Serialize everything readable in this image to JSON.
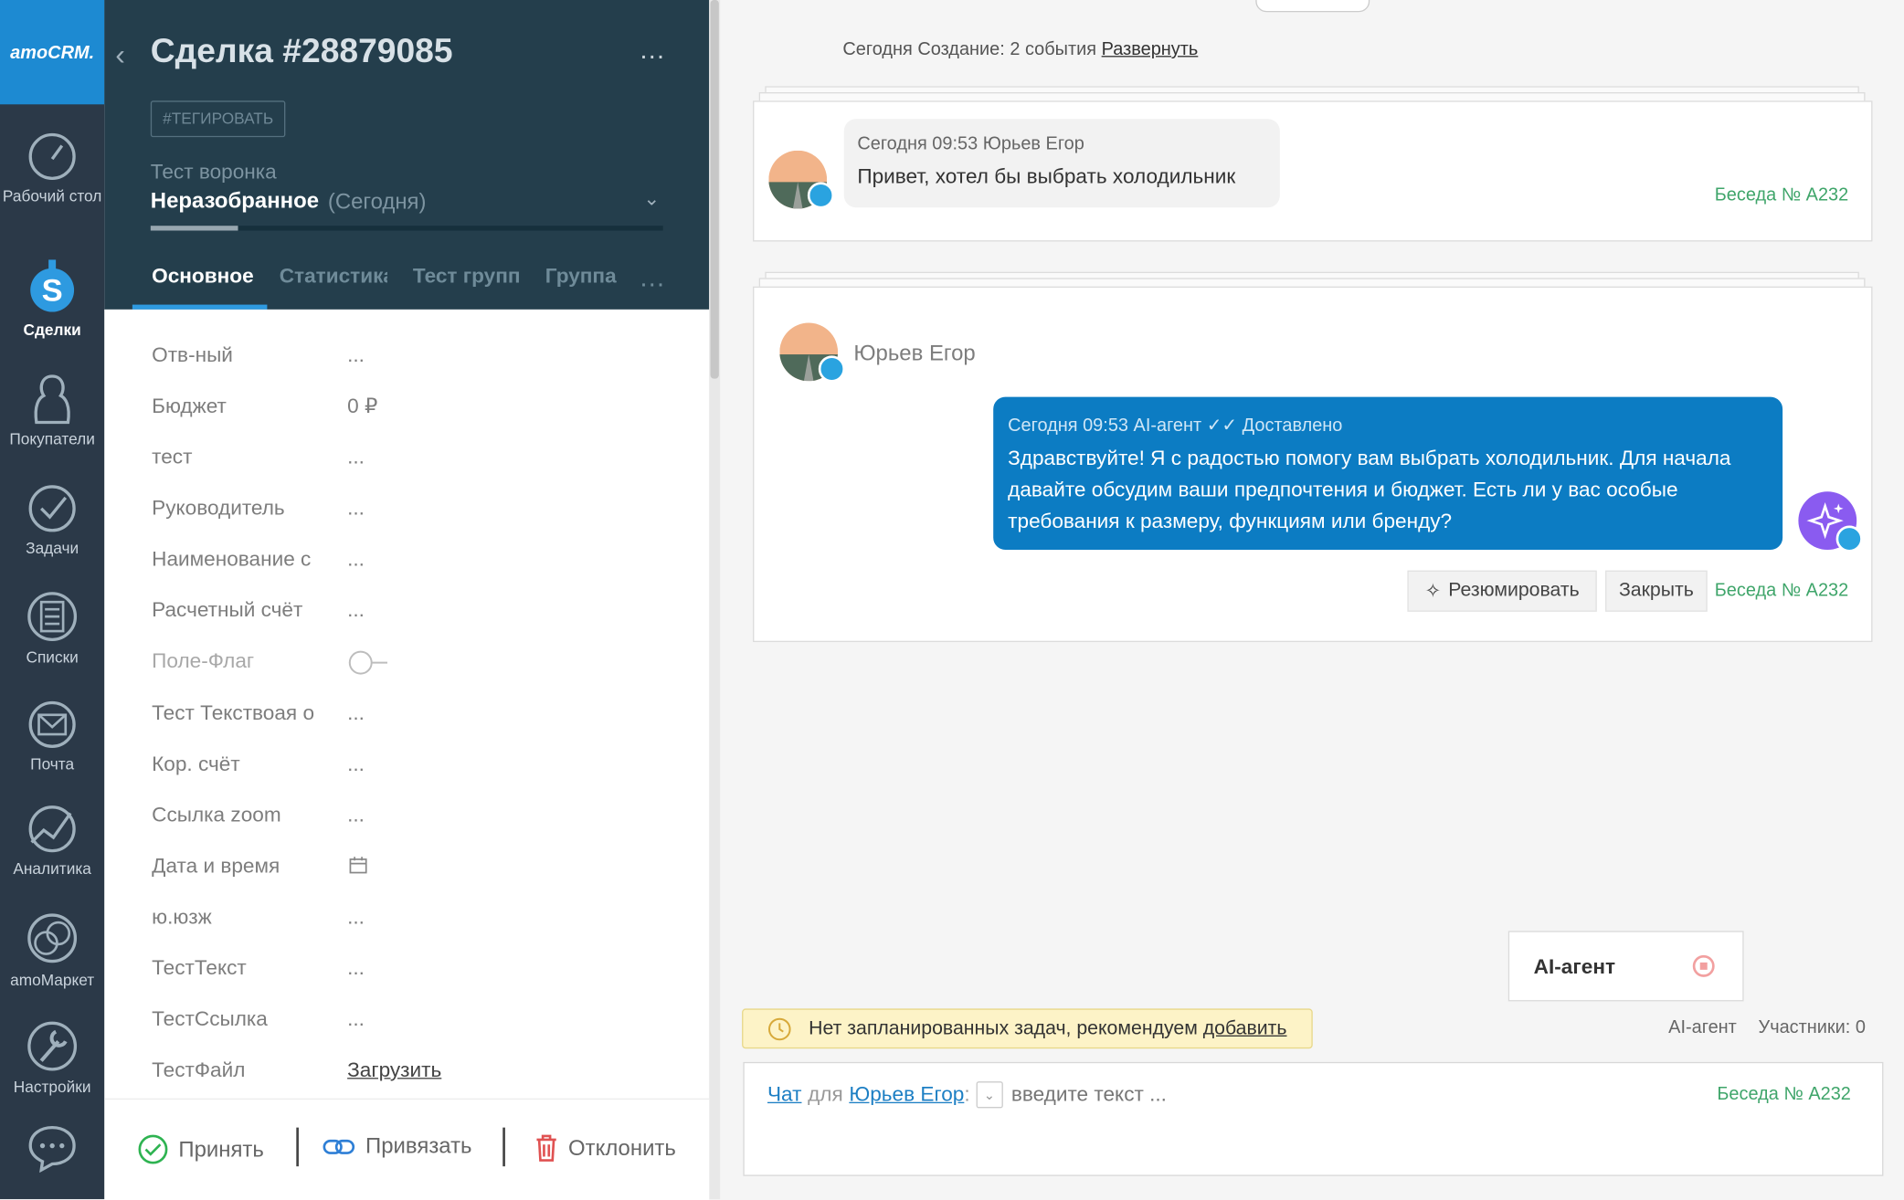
{
  "nav": {
    "logo": "amoCRM.",
    "items": [
      {
        "label": "Рабочий стол",
        "icon": "dashboard-gauge-icon"
      },
      {
        "label": "Сделки",
        "icon": "deals-dollar-icon",
        "active": true
      },
      {
        "label": "Покупатели",
        "icon": "customers-icon"
      },
      {
        "label": "Задачи",
        "icon": "tasks-check-icon"
      },
      {
        "label": "Списки",
        "icon": "lists-icon"
      },
      {
        "label": "Почта",
        "icon": "mail-icon"
      },
      {
        "label": "Аналитика",
        "icon": "analytics-icon"
      },
      {
        "label": "amoМаркет",
        "icon": "market-icon"
      },
      {
        "label": "Настройки",
        "icon": "settings-wrench-icon"
      }
    ],
    "chat_icon": "chat-bubble-icon"
  },
  "deal": {
    "title": "Сделка #28879085",
    "menu": "…",
    "tag_button": "#ТЕГИРОВАТЬ",
    "pipeline": "Тест воронка",
    "stage": "Неразобранное",
    "stage_date": "(Сегодня)",
    "progress": 0.17,
    "tabs": [
      "Основное",
      "Статистика",
      "Тест групп",
      "Группа"
    ],
    "tabs_more": "…"
  },
  "fields": [
    {
      "label": "Отв-ный",
      "value": "..."
    },
    {
      "label": "Бюджет",
      "value": "0 ₽"
    },
    {
      "label": "тест",
      "value": "..."
    },
    {
      "label": "Руководитель",
      "value": "..."
    },
    {
      "label": "Наименование с",
      "value": "..."
    },
    {
      "label": "Расчетный счёт",
      "value": "..."
    },
    {
      "label": "Поле-Флаг",
      "value": ""
    },
    {
      "label": "Тест Текствоая о",
      "value": "..."
    },
    {
      "label": "Кор. счёт",
      "value": "..."
    },
    {
      "label": "Ссылка zoom",
      "value": "..."
    },
    {
      "label": "Дата и время",
      "value": ""
    },
    {
      "label": "ю.юзж",
      "value": "..."
    },
    {
      "label": "ТестТекст",
      "value": "..."
    },
    {
      "label": "ТестСсылка",
      "value": "..."
    },
    {
      "label": "ТестФайл",
      "value": "Загрузить"
    }
  ],
  "actions": {
    "accept": "Принять",
    "link": "Привязать",
    "decline": "Отклонить"
  },
  "feed": {
    "header_text": "Сегодня Создание: 2 события",
    "expand": "Развернуть",
    "msg1": {
      "meta": "Сегодня 09:53 Юрьев Егор",
      "text": "Привет, хотел бы выбрать холодильник",
      "conv": "Беседа № А232"
    },
    "msg2": {
      "sender": "Юрьев Егор",
      "meta": "Сегодня 09:53 AI-агент",
      "status": "Доставлено",
      "text": "Здравствуйте! Я с радостью помогу вам выбрать холодильник. Для начала давайте обсудим ваши предпочтения и бюджет. Есть ли у вас особые требования к размеру, функциям или бренду?",
      "summarize": "Резюмировать",
      "close": "Закрыть",
      "conv": "Беседа № А232"
    }
  },
  "ai_box": {
    "label": "AI-агент"
  },
  "notice": {
    "text": "Нет запланированных задач, рекомендуем",
    "link": "добавить"
  },
  "participants": {
    "agent": "AI-агент",
    "count": "Участники: 0"
  },
  "composer": {
    "chat": "Чат",
    "for": "для",
    "recipient": "Юрьев Егор",
    "colon": ":",
    "placeholder": "введите текст ...",
    "conv": "Беседа № А232"
  }
}
